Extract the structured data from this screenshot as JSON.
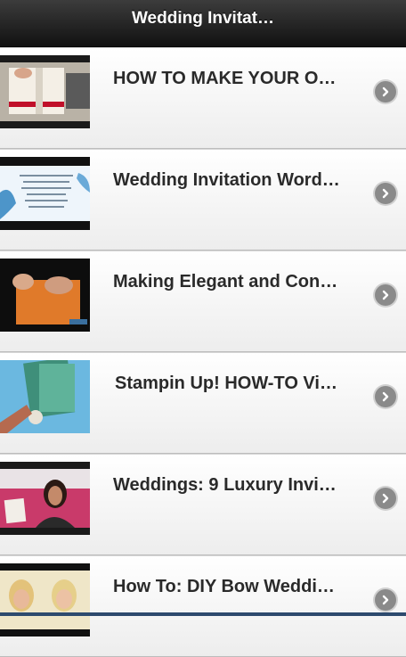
{
  "header": {
    "title": "Wedding Invitat…"
  },
  "items": [
    {
      "title": "HOW TO MAKE YOUR O…",
      "thumb": "paper-card-ribbon"
    },
    {
      "title": "Wedding Invitation Word…",
      "thumb": "invitation-text-card"
    },
    {
      "title": "Making Elegant and Con…",
      "thumb": "orange-card-hands"
    },
    {
      "title": "Stampin Up! HOW-TO Vi…",
      "thumb": "stamping-cards-blue"
    },
    {
      "title": "Weddings: 9 Luxury Invi…",
      "thumb": "presenter-with-card"
    },
    {
      "title": "How To: DIY Bow Weddi…",
      "thumb": "two-women-studio"
    }
  ],
  "icons": {
    "arrow": "chevron-right-circle-icon"
  }
}
